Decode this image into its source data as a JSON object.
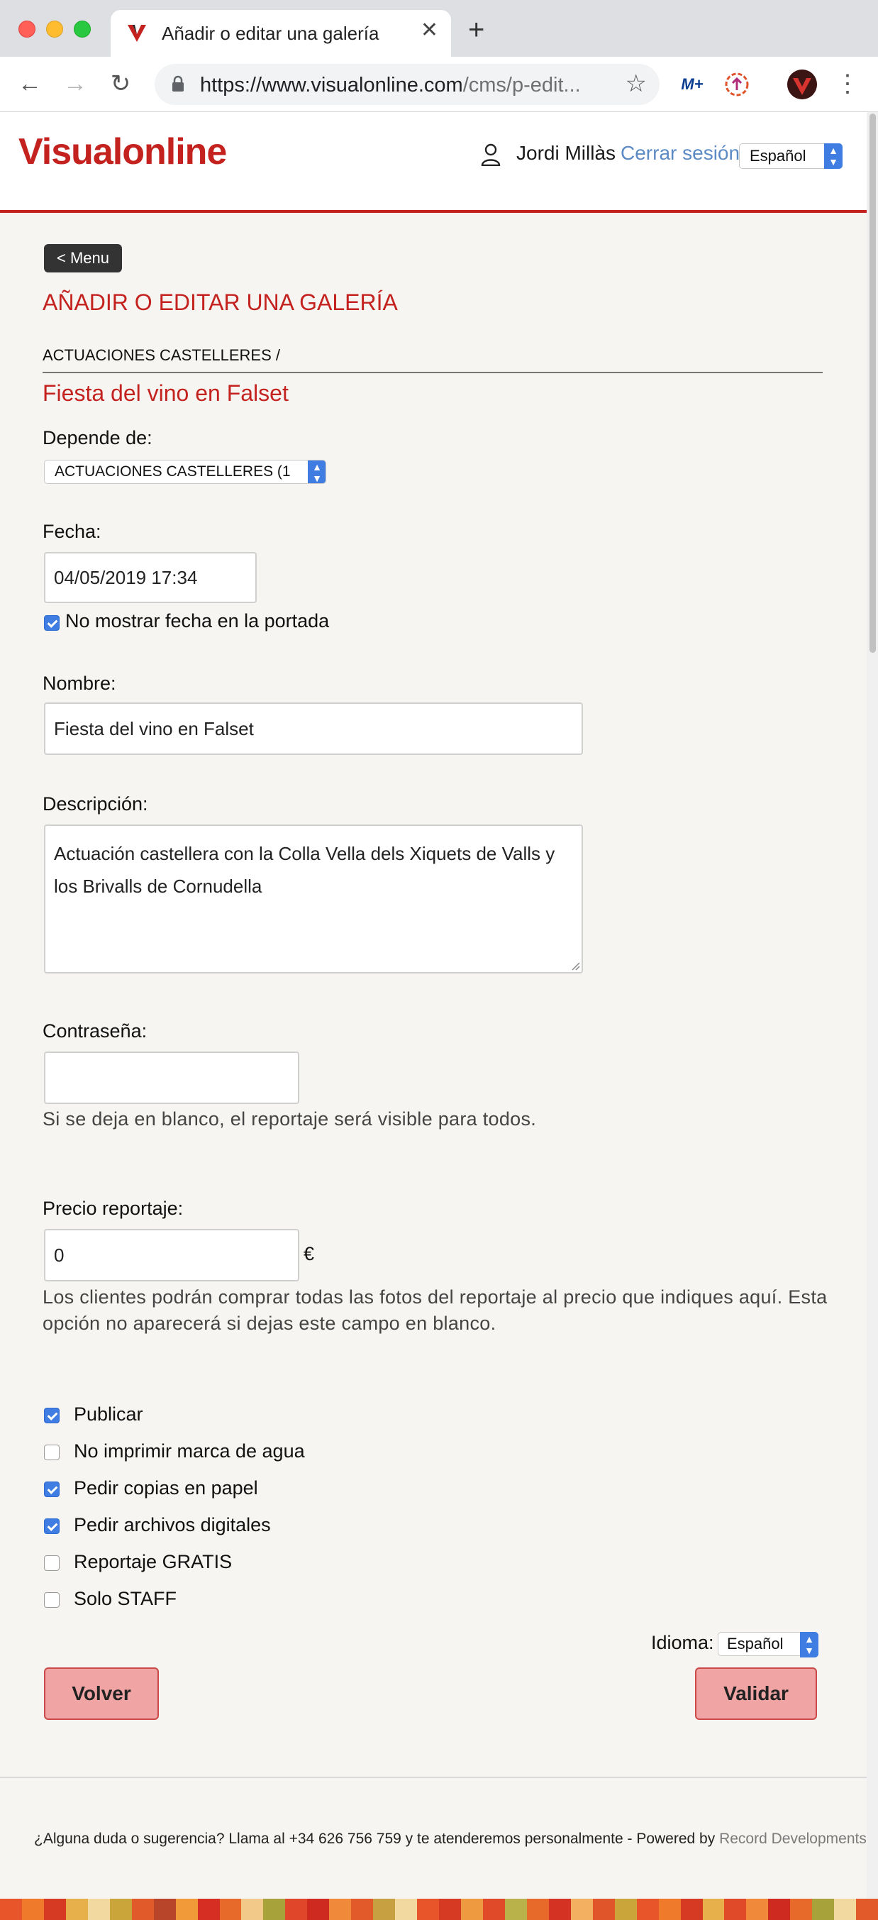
{
  "browser": {
    "tab_title": "Añadir o editar una galería",
    "url_host": "https://www.visualonline.com",
    "url_path": "/cms/p-edit...",
    "extension_m_label": "M+"
  },
  "header": {
    "logo_text": "Visualonline",
    "user_name": "Jordi Millàs",
    "logout_label": "Cerrar sesión",
    "language": "Español"
  },
  "page": {
    "menu_button": "< Menu",
    "title": "AÑADIR O EDITAR UNA GALERÍA",
    "breadcrumb": "ACTUACIONES CASTELLERES /",
    "gallery_name": "Fiesta del vino en Falset"
  },
  "form": {
    "depende_label": "Depende de:",
    "depende_value": "ACTUACIONES CASTELLERES (1",
    "fecha_label": "Fecha:",
    "fecha_value": "04/05/2019 17:34",
    "no_fecha_label": "No mostrar fecha en la portada",
    "no_fecha_checked": true,
    "nombre_label": "Nombre:",
    "nombre_value": "Fiesta del vino en Falset",
    "descripcion_label": "Descripción:",
    "descripcion_value": "Actuación castellera con la Colla Vella dels Xiquets de Valls y los Brivalls de Cornudella",
    "password_label": "Contraseña:",
    "password_value": "",
    "password_help": "Si se deja en blanco, el reportaje será visible para todos.",
    "precio_label": "Precio reportaje:",
    "precio_value": "0",
    "currency": "€",
    "precio_help": "Los clientes podrán comprar todas las fotos del reportaje al precio que indiques aquí. Esta opción no aparecerá si dejas este campo en blanco.",
    "options": [
      {
        "label": "Publicar",
        "checked": true
      },
      {
        "label": "No imprimir marca de agua",
        "checked": false
      },
      {
        "label": "Pedir copias en papel",
        "checked": true
      },
      {
        "label": "Pedir archivos digitales",
        "checked": true
      },
      {
        "label": "Reportaje GRATIS",
        "checked": false
      },
      {
        "label": "Solo STAFF",
        "checked": false
      }
    ],
    "idioma_label": "Idioma:",
    "idioma_value": "Español",
    "back_button": "Volver",
    "submit_button": "Validar"
  },
  "footer": {
    "text": "¿Alguna duda o sugerencia? Llama al +34 626 756 759 y te atenderemos personalmente - Powered by ",
    "link": "Record Developments"
  },
  "colors": {
    "brand_red": "#c4221f",
    "link_blue": "#5b8ac4",
    "checkbox_blue": "#3f7de3",
    "button_fill": "#f0a4a3"
  }
}
